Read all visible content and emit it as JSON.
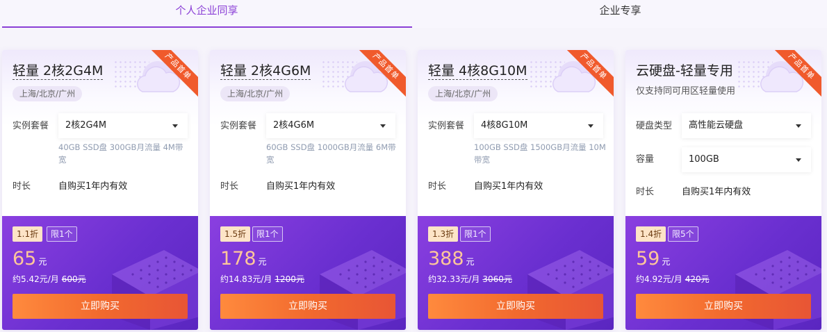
{
  "tabs": [
    {
      "label": "个人企业同享",
      "active": true
    },
    {
      "label": "企业专享",
      "active": false
    }
  ],
  "colors": {
    "accent": "#8a3fd6",
    "ribbon": "#f05a2c",
    "button": "#f26a2e",
    "price": "#ffc79a"
  },
  "ribbon_text": "产品首单",
  "labels": {
    "plan": "实例套餐",
    "duration": "时长",
    "disk_type": "硬盘类型",
    "capacity": "容量"
  },
  "cards": [
    {
      "title": "轻量 2核2G4M",
      "region": "上海/北京/广州",
      "plan_value": "2核2G4M",
      "desc": "40GB SSD盘 300GB月流量 4M带宽",
      "duration_value": "自购买1年内有效",
      "discount": "1.1折",
      "limit": "限1个",
      "price": "65",
      "price_unit": "元",
      "monthly": "约5.42元/月",
      "original": "600元",
      "buy_label": "立即购买"
    },
    {
      "title": "轻量 2核4G6M",
      "region": "上海/北京/广州",
      "plan_value": "2核4G6M",
      "desc": "60GB SSD盘 1000GB月流量 6M带宽",
      "duration_value": "自购买1年内有效",
      "discount": "1.5折",
      "limit": "限1个",
      "price": "178",
      "price_unit": "元",
      "monthly": "约14.83元/月",
      "original": "1200元",
      "buy_label": "立即购买"
    },
    {
      "title": "轻量 4核8G10M",
      "region": "上海/北京/广州",
      "plan_value": "4核8G10M",
      "desc": "100GB SSD盘 1500GB月流量 10M带宽",
      "duration_value": "自购买1年内有效",
      "discount": "1.3折",
      "limit": "限1个",
      "price": "388",
      "price_unit": "元",
      "monthly": "约32.33元/月",
      "original": "3060元",
      "buy_label": "立即购买"
    },
    {
      "title": "云硬盘-轻量专用",
      "subtitle": "仅支持同可用区轻量使用",
      "disk_type_value": "高性能云硬盘",
      "capacity_value": "100GB",
      "duration_value": "自购买1年内有效",
      "discount": "1.4折",
      "limit": "限5个",
      "price": "59",
      "price_unit": "元",
      "monthly": "约4.92元/月",
      "original": "420元",
      "buy_label": "立即购买"
    }
  ]
}
